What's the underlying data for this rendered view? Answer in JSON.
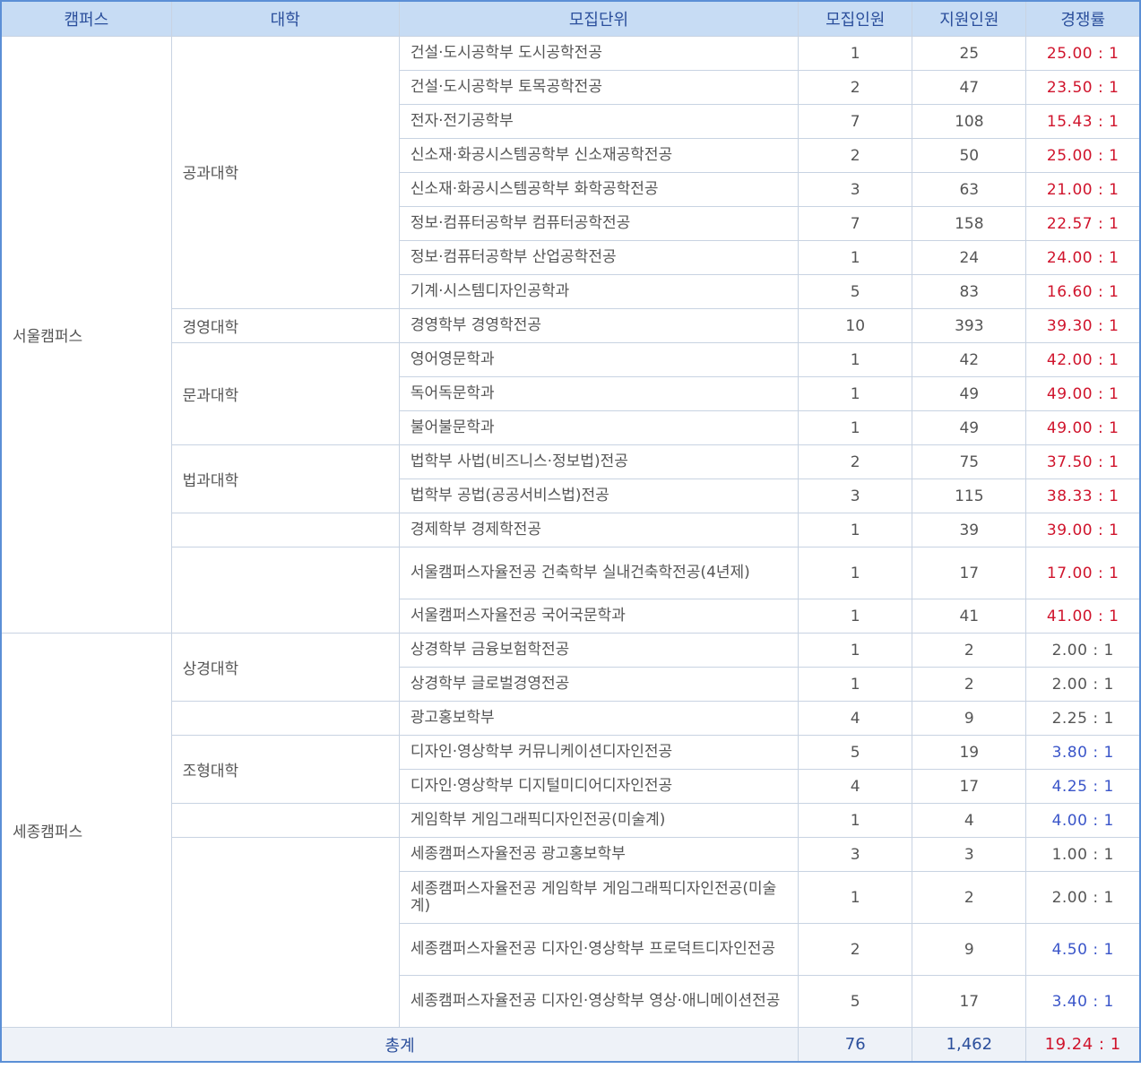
{
  "headers": {
    "campus": "캠퍼스",
    "college": "대학",
    "unit": "모집단위",
    "quota": "모집인원",
    "applicants": "지원인원",
    "rate": "경쟁률"
  },
  "campuses": [
    {
      "name": "서울캠퍼스",
      "colleges": [
        {
          "name": "공과대학",
          "rows": [
            {
              "unit": "건설·도시공학부 도시공학전공",
              "quota": "1",
              "applicants": "25",
              "rate": "25.00 : 1"
            },
            {
              "unit": "건설·도시공학부 토목공학전공",
              "quota": "2",
              "applicants": "47",
              "rate": "23.50 : 1"
            },
            {
              "unit": "전자·전기공학부",
              "quota": "7",
              "applicants": "108",
              "rate": "15.43 : 1"
            },
            {
              "unit": "신소재·화공시스템공학부 신소재공학전공",
              "quota": "2",
              "applicants": "50",
              "rate": "25.00 : 1"
            },
            {
              "unit": "신소재·화공시스템공학부 화학공학전공",
              "quota": "3",
              "applicants": "63",
              "rate": "21.00 : 1"
            },
            {
              "unit": "정보·컴퓨터공학부 컴퓨터공학전공",
              "quota": "7",
              "applicants": "158",
              "rate": "22.57 : 1"
            },
            {
              "unit": "정보·컴퓨터공학부 산업공학전공",
              "quota": "1",
              "applicants": "24",
              "rate": "24.00 : 1"
            },
            {
              "unit": "기계·시스템디자인공학과",
              "quota": "5",
              "applicants": "83",
              "rate": "16.60 : 1"
            }
          ]
        },
        {
          "name": "경영대학",
          "rows": [
            {
              "unit": "경영학부 경영학전공",
              "quota": "10",
              "applicants": "393",
              "rate": "39.30 : 1"
            }
          ]
        },
        {
          "name": "문과대학",
          "rows": [
            {
              "unit": "영어영문학과",
              "quota": "1",
              "applicants": "42",
              "rate": "42.00 : 1"
            },
            {
              "unit": "독어독문학과",
              "quota": "1",
              "applicants": "49",
              "rate": "49.00 : 1"
            },
            {
              "unit": "불어불문학과",
              "quota": "1",
              "applicants": "49",
              "rate": "49.00 : 1"
            }
          ]
        },
        {
          "name": "법과대학",
          "rows": [
            {
              "unit": "법학부 사법(비즈니스·정보법)전공",
              "quota": "2",
              "applicants": "75",
              "rate": "37.50 : 1"
            },
            {
              "unit": "법학부 공법(공공서비스법)전공",
              "quota": "3",
              "applicants": "115",
              "rate": "38.33 : 1"
            }
          ]
        },
        {
          "name": "",
          "rows": [
            {
              "unit": "경제학부 경제학전공",
              "quota": "1",
              "applicants": "39",
              "rate": "39.00 : 1"
            }
          ]
        },
        {
          "name": "",
          "rows": [
            {
              "unit": "서울캠퍼스자율전공 건축학부 실내건축학전공(4년제)",
              "quota": "1",
              "applicants": "17",
              "rate": "17.00 : 1"
            },
            {
              "unit": "서울캠퍼스자율전공 국어국문학과",
              "quota": "1",
              "applicants": "41",
              "rate": "41.00 : 1"
            }
          ]
        }
      ]
    },
    {
      "name": "세종캠퍼스",
      "colleges": [
        {
          "name": "상경대학",
          "rows": [
            {
              "unit": "상경학부 금융보험학전공",
              "quota": "1",
              "applicants": "2",
              "rate": "2.00 : 1"
            },
            {
              "unit": "상경학부 글로벌경영전공",
              "quota": "1",
              "applicants": "2",
              "rate": "2.00 : 1"
            }
          ]
        },
        {
          "name": "",
          "rows": [
            {
              "unit": "광고홍보학부",
              "quota": "4",
              "applicants": "9",
              "rate": "2.25 : 1"
            }
          ]
        },
        {
          "name": "조형대학",
          "rows": [
            {
              "unit": "디자인·영상학부 커뮤니케이션디자인전공",
              "quota": "5",
              "applicants": "19",
              "rate": "3.80 : 1"
            },
            {
              "unit": "디자인·영상학부 디지털미디어디자인전공",
              "quota": "4",
              "applicants": "17",
              "rate": "4.25 : 1"
            }
          ]
        },
        {
          "name": "",
          "rows": [
            {
              "unit": "게임학부 게임그래픽디자인전공(미술계)",
              "quota": "1",
              "applicants": "4",
              "rate": "4.00 : 1"
            }
          ]
        },
        {
          "name": "",
          "rows": [
            {
              "unit": "세종캠퍼스자율전공 광고홍보학부",
              "quota": "3",
              "applicants": "3",
              "rate": "1.00 : 1"
            },
            {
              "unit": "세종캠퍼스자율전공 게임학부 게임그래픽디자인전공(미술계)",
              "quota": "1",
              "applicants": "2",
              "rate": "2.00 : 1"
            },
            {
              "unit": "세종캠퍼스자율전공 디자인·영상학부 프로덕트디자인전공",
              "quota": "2",
              "applicants": "9",
              "rate": "4.50 : 1"
            },
            {
              "unit": "세종캠퍼스자율전공 디자인·영상학부 영상·애니메이션전공",
              "quota": "5",
              "applicants": "17",
              "rate": "3.40 : 1"
            }
          ]
        }
      ]
    }
  ],
  "rate_colors": {
    "red": "#d0142c",
    "blue": "#3a55c9",
    "dark": "#555555"
  },
  "total": {
    "label": "총계",
    "quota": "76",
    "applicants": "1,462",
    "rate": "19.24 : 1"
  }
}
